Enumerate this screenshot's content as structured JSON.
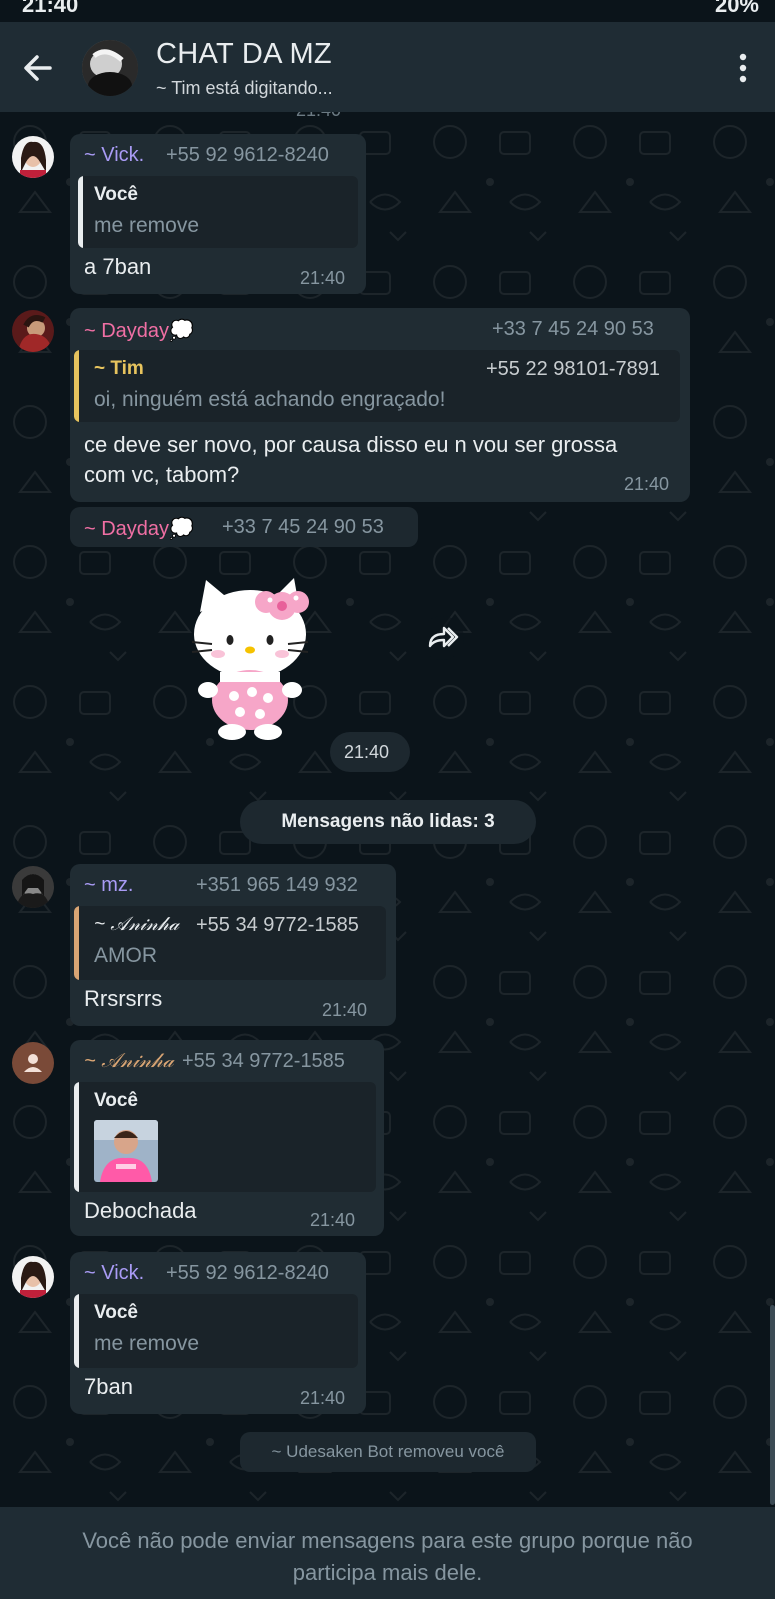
{
  "status": {
    "time": "21:40",
    "right": "20%"
  },
  "header": {
    "title": "CHAT DA MZ",
    "subtitle": "~ Tim está digitando..."
  },
  "messages": [
    {
      "sender": "~ Vick.",
      "phone": "+55 92 9612-8240",
      "quote_name": "Você",
      "quote_text": "me remove",
      "text": "a 7ban",
      "time": "21:40"
    },
    {
      "sender": "~ Dayday💭",
      "phone": "+33 7 45 24 90 53",
      "quote_name": "~ Tim",
      "quote_phone": "+55 22 98101-7891",
      "quote_text": "oi, ninguém está achando engraçado!",
      "text_line1": "ce deve ser novo, por causa disso eu n vou ser grossa",
      "text_line2": "com vc, tabom?",
      "time": "21:40"
    },
    {
      "sender": "~ Dayday💭",
      "phone": "+33 7 45 24 90 53",
      "time": "21:40"
    },
    {
      "sender": "~ mz.",
      "phone": "+351 965 149 932",
      "quote_name": "~ 𝒜𝓃𝒾𝓃𝒽𝒶",
      "quote_phone": "+55 34 9772-1585",
      "quote_text": "AMOR",
      "text": "Rrsrsrrs",
      "time": "21:40"
    },
    {
      "sender": "~ 𝒜𝓃𝒾𝓃𝒽𝒶",
      "phone": "+55 34 9772-1585",
      "quote_name": "Você",
      "text": "Debochada",
      "time": "21:40"
    },
    {
      "sender": "~ Vick.",
      "phone": "+55 92 9612-8240",
      "quote_name": "Você",
      "quote_text": "me remove",
      "text": "7ban",
      "time": "21:40"
    }
  ],
  "unread_divider": "Mensagens não lidas: 3",
  "system_notice": "~ Udesaken Bot removeu você",
  "footer": {
    "line1": "Você não pode enviar mensagens para este grupo porque não",
    "line2": "participa mais dele."
  },
  "colors": {
    "header_bg": "#1f2c34",
    "chat_bg": "#0b141a",
    "bubble_bg": "#202c33",
    "vick_name": "#a99bf5",
    "dayday_name": "#f06fa4",
    "mz_name": "#a99bf5",
    "aninha_name": "#d9a574",
    "tim_name": "#e7c45e"
  }
}
